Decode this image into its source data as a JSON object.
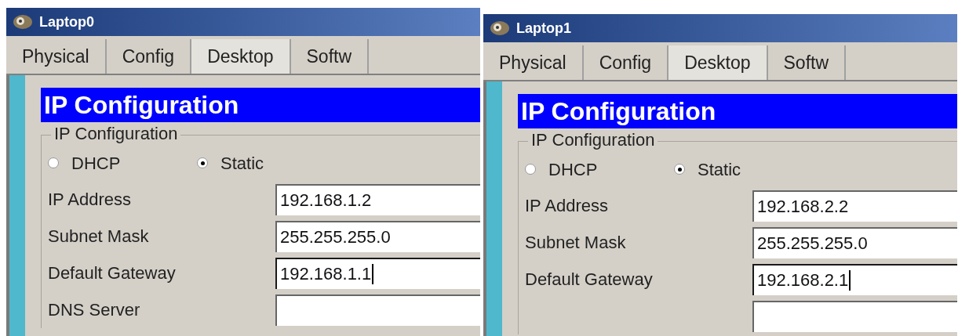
{
  "windows": [
    {
      "title": "Laptop0",
      "tabs": [
        {
          "label": "Physical",
          "selected": false
        },
        {
          "label": "Config",
          "selected": false
        },
        {
          "label": "Desktop",
          "selected": true
        },
        {
          "label": "Softw",
          "selected": false
        }
      ],
      "heading": "IP Configuration",
      "group_label": "IP Configuration",
      "modes": [
        {
          "label": "DHCP",
          "selected": false
        },
        {
          "label": "Static",
          "selected": true
        }
      ],
      "fields": [
        {
          "label": "IP Address",
          "value": "192.168.1.2",
          "focused": false
        },
        {
          "label": "Subnet Mask",
          "value": "255.255.255.0",
          "focused": false
        },
        {
          "label": "Default Gateway",
          "value": "192.168.1.1",
          "focused": true
        },
        {
          "label": "DNS Server",
          "focused": false
        }
      ]
    },
    {
      "title": "Laptop1",
      "tabs": [
        {
          "label": "Physical",
          "selected": false
        },
        {
          "label": "Config",
          "selected": false
        },
        {
          "label": "Desktop",
          "selected": true
        },
        {
          "label": "Softw",
          "selected": false
        }
      ],
      "heading": "IP Configuration",
      "group_label": "IP Configuration",
      "modes": [
        {
          "label": "DHCP",
          "selected": false
        },
        {
          "label": "Static",
          "selected": true
        }
      ],
      "fields": [
        {
          "label": "IP Address",
          "value": "192.168.2.2",
          "focused": false
        },
        {
          "label": "Subnet Mask",
          "value": "255.255.255.0",
          "focused": false
        },
        {
          "label": "Default Gateway",
          "value": "192.168.2.1",
          "focused": true
        },
        {
          "focused": false
        }
      ]
    }
  ]
}
